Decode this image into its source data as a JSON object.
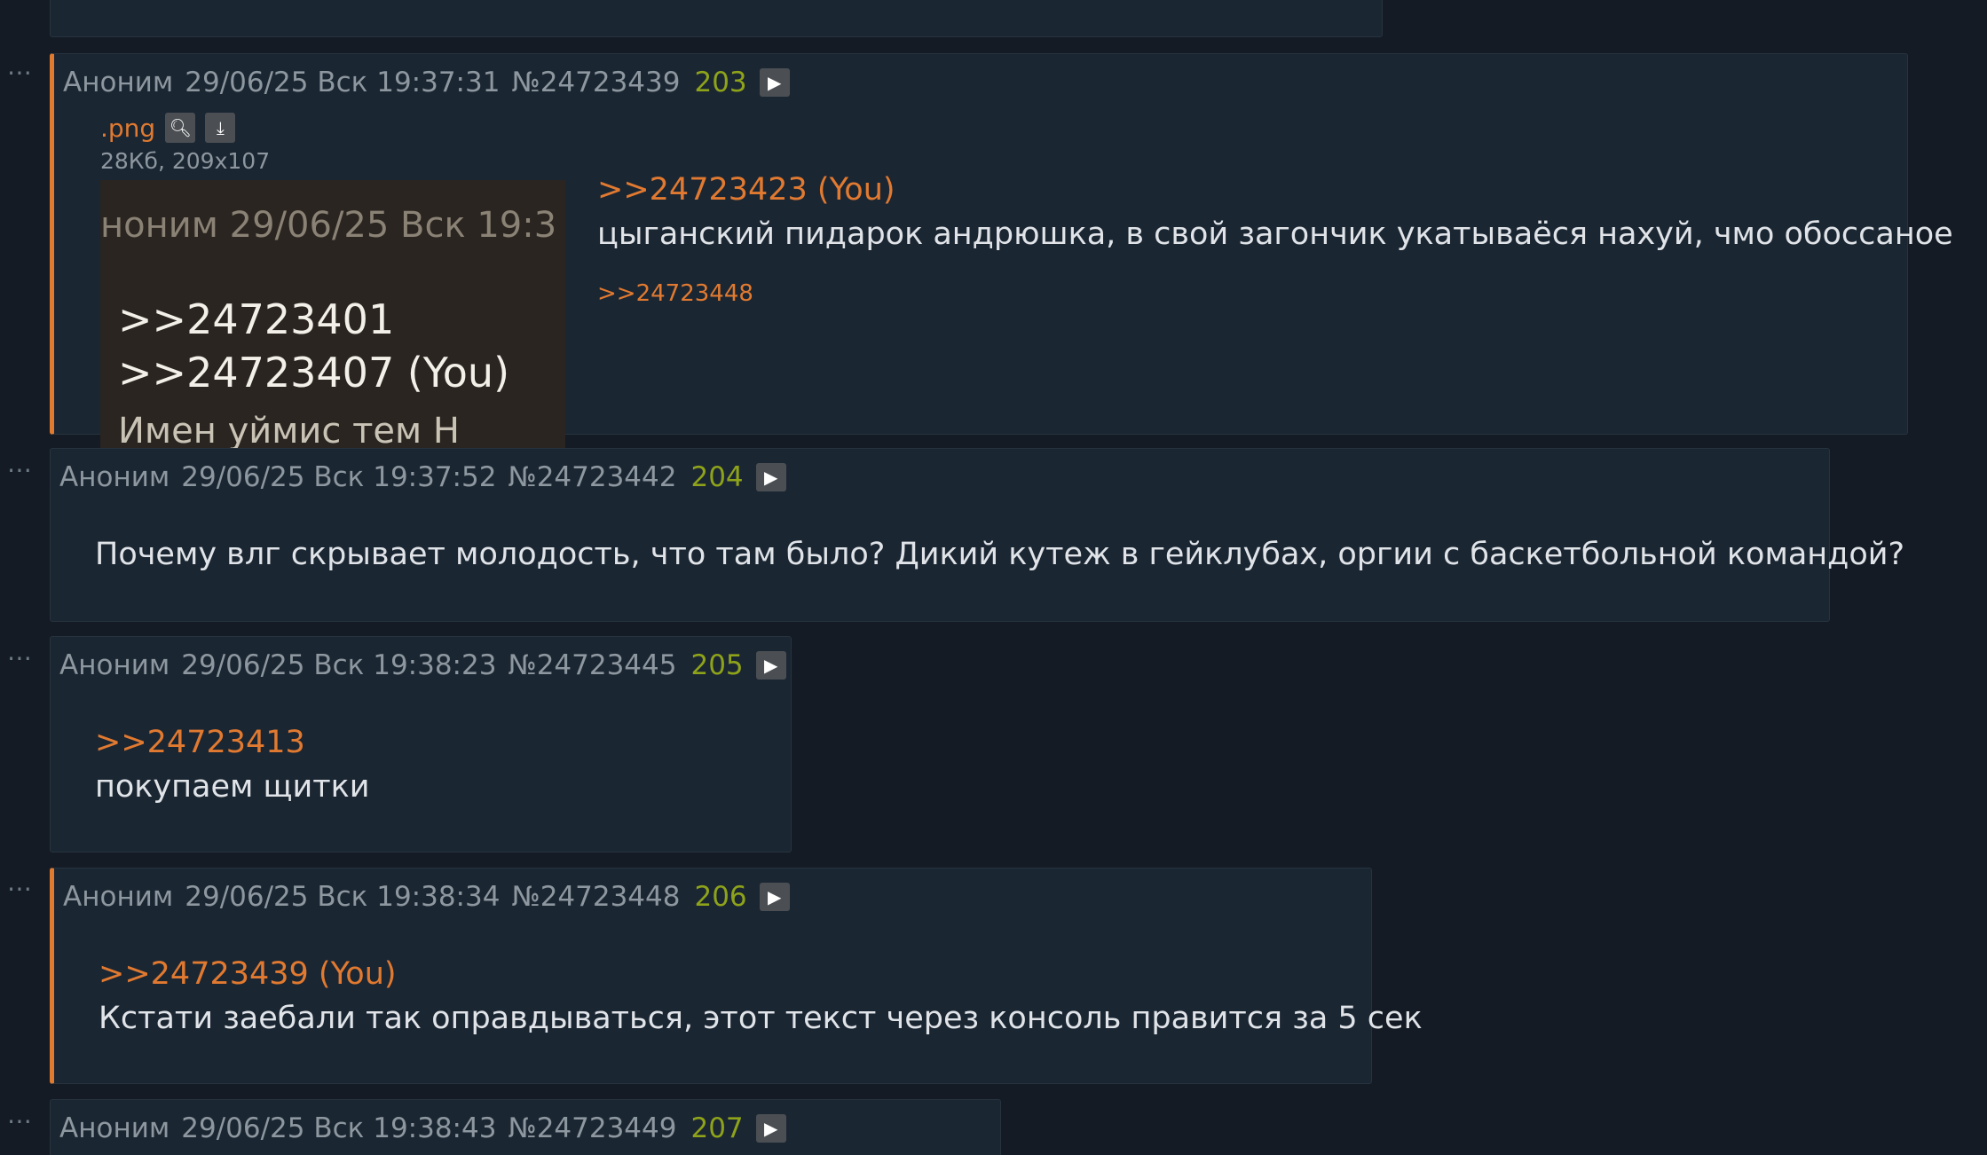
{
  "posts": [
    {
      "id": "top",
      "header": null
    },
    {
      "author": "Аноним",
      "date": "29/06/25 Вск 19:37:31",
      "number": "№24723439",
      "count": "203",
      "file": {
        "name": ".png",
        "size": "28Кб, 209x107",
        "thumb_lines": [
          "ноним 29/06/25 Вск 19:3",
          ">>24723401",
          ">>24723407 (You)",
          "Имен  уймис  тем  Н"
        ]
      },
      "reply_link": ">>24723423 (You)",
      "text": "цыганский пидарок андрюшка, в свой загончик укатывaёся нахуй, чмо обоссаное",
      "backlink": ">>24723448"
    },
    {
      "author": "Аноним",
      "date": "29/06/25 Вск 19:37:52",
      "number": "№24723442",
      "count": "204",
      "text": "Почему влг скрывает молодость, что там было? Дикий кутеж в гейклубах, оргии с баскетбольной командой?"
    },
    {
      "author": "Аноним",
      "date": "29/06/25 Вск 19:38:23",
      "number": "№24723445",
      "count": "205",
      "reply_link": ">>24723413",
      "text": "покупаем щитки"
    },
    {
      "author": "Аноним",
      "date": "29/06/25 Вск 19:38:34",
      "number": "№24723448",
      "count": "206",
      "reply_link": ">>24723439 (You)",
      "text": "Кстати заебали так оправдываться, этот текст через консоль правится за 5 сек"
    },
    {
      "author": "Аноним",
      "date": "29/06/25 Вск 19:38:43",
      "number": "№24723449",
      "count": "207"
    }
  ],
  "icons": {
    "menu": "more-dots-icon",
    "play": "play-icon",
    "search": "search-icon",
    "download": "download-icon"
  },
  "colors": {
    "background": "#141b24",
    "post_bg": "#1b2633",
    "link": "#e17a30",
    "count": "#8ea31a",
    "own_post_border": "#e07a2f"
  }
}
